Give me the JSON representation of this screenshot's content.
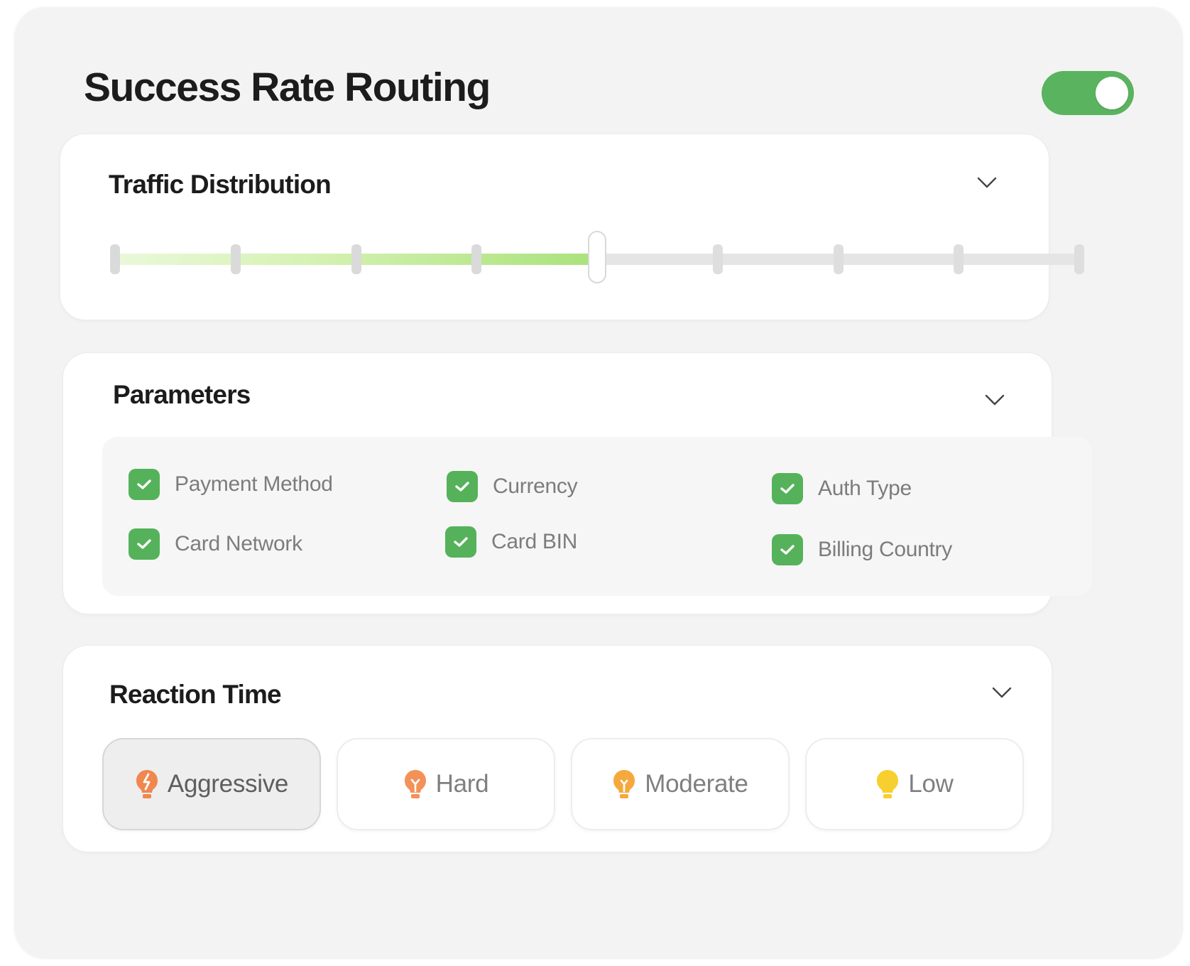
{
  "header": {
    "title": "Success Rate Routing",
    "toggle_on": true
  },
  "traffic": {
    "title": "Traffic Distribution",
    "value_fraction": 0.5,
    "steps": 9
  },
  "parameters": {
    "title": "Parameters",
    "items": [
      {
        "label": "Payment Method",
        "checked": true
      },
      {
        "label": "Currency",
        "checked": true
      },
      {
        "label": "Auth Type",
        "checked": true
      },
      {
        "label": "Card Network",
        "checked": true
      },
      {
        "label": "Card BIN",
        "checked": true
      },
      {
        "label": "Billing Country",
        "checked": true
      }
    ]
  },
  "reaction": {
    "title": "Reaction Time",
    "selected": "Aggressive",
    "options": [
      {
        "label": "Aggressive",
        "icon": "bulb-bolt-icon",
        "color": "#f0874f"
      },
      {
        "label": "Hard",
        "icon": "bulb-icon",
        "color": "#f39158"
      },
      {
        "label": "Moderate",
        "icon": "bulb-icon",
        "color": "#f5a93d"
      },
      {
        "label": "Low",
        "icon": "bulb-icon",
        "color": "#f7cf2f"
      }
    ]
  },
  "colors": {
    "accent_green": "#55b25a",
    "toggle_green": "#5ab35e",
    "slider_fill_end": "#a9e27b"
  }
}
